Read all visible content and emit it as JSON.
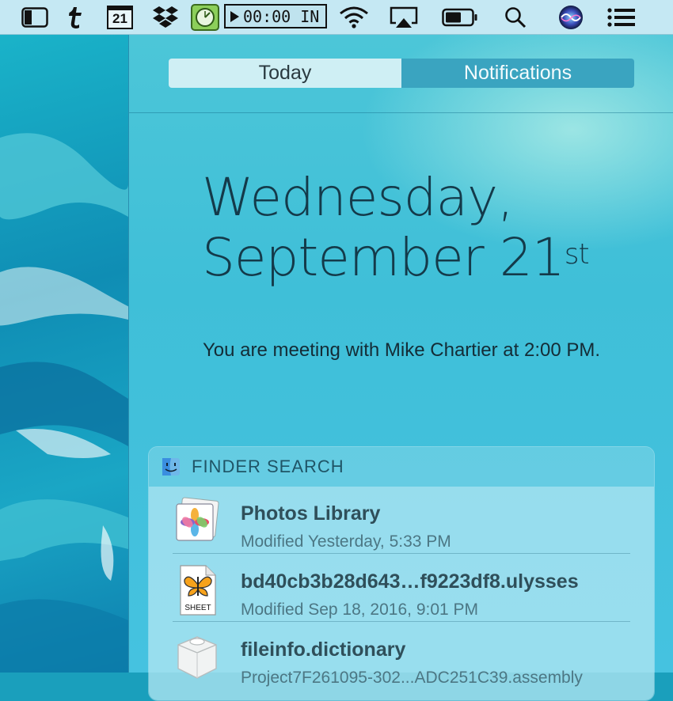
{
  "menubar": {
    "calendar_day": "21",
    "timer_text": "00:00 IN"
  },
  "panel": {
    "tabs": [
      {
        "label": "Today"
      },
      {
        "label": "Notifications"
      }
    ],
    "date_line1": "Wednesday,",
    "date_line2": "September 21",
    "date_suffix": "st",
    "meeting_text": "You are meeting with Mike Chartier at 2:00 PM."
  },
  "finder_search": {
    "title": "FINDER SEARCH",
    "results": [
      {
        "name": "Photos Library",
        "subtitle": "Modified Yesterday, 5:33 PM",
        "icon": "photos-library-icon"
      },
      {
        "name": "bd40cb3b28d643…f9223df8.ulysses",
        "subtitle": "Modified Sep 18, 2016, 9:01 PM",
        "icon": "ulysses-sheet-icon",
        "icon_label": "SHEET"
      },
      {
        "name": "fileinfo.dictionary",
        "subtitle": "Project7F261095-302...ADC251C39.assembly",
        "icon": "dictionary-bundle-icon"
      }
    ]
  }
}
